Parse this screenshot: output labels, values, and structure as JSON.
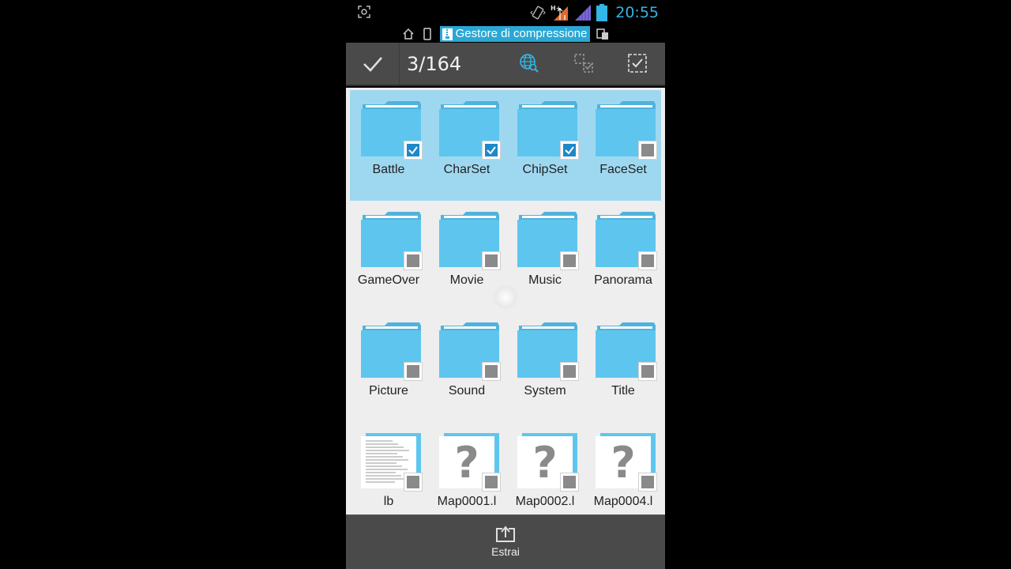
{
  "status_bar": {
    "time": "20:55",
    "network": "H+",
    "colors": {
      "time": "#33b5e5",
      "battery": "#33b5e5",
      "signal": "#7a6ad8",
      "network": "#e06a2a"
    }
  },
  "ticker": {
    "title": "Gestore di compressione"
  },
  "action_bar": {
    "selection_count": "3/164"
  },
  "grid": {
    "items": [
      {
        "label": "Battle",
        "kind": "folder",
        "checked": true
      },
      {
        "label": "CharSet",
        "kind": "folder",
        "checked": true
      },
      {
        "label": "ChipSet",
        "kind": "folder",
        "checked": true
      },
      {
        "label": "FaceSet",
        "kind": "folder",
        "checked": false
      },
      {
        "label": "GameOver",
        "kind": "folder",
        "checked": false
      },
      {
        "label": "Movie",
        "kind": "folder",
        "checked": false
      },
      {
        "label": "Music",
        "kind": "folder",
        "checked": false
      },
      {
        "label": "Panorama",
        "kind": "folder",
        "checked": false
      },
      {
        "label": "Picture",
        "kind": "folder",
        "checked": false
      },
      {
        "label": "Sound",
        "kind": "folder",
        "checked": false
      },
      {
        "label": "System",
        "kind": "folder",
        "checked": false
      },
      {
        "label": "Title",
        "kind": "folder",
        "checked": false
      },
      {
        "label": "lb",
        "kind": "text-file",
        "checked": false
      },
      {
        "label": "Map0001.l",
        "kind": "unknown-file",
        "checked": false
      },
      {
        "label": "Map0002.l",
        "kind": "unknown-file",
        "checked": false
      },
      {
        "label": "Map0004.l",
        "kind": "unknown-file",
        "checked": false
      }
    ]
  },
  "bottom_bar": {
    "extract_label": "Estrai"
  },
  "colors": {
    "folder": "#5ec6ee",
    "folder_tab": "#4fb3dd",
    "selection_band": "#9ed8f0",
    "checkbox_checked": "#1e88c8",
    "checkbox_unchecked": "#8a8a8a",
    "actionbar": "#4a4a4a",
    "content_bg": "#eeeeee"
  }
}
